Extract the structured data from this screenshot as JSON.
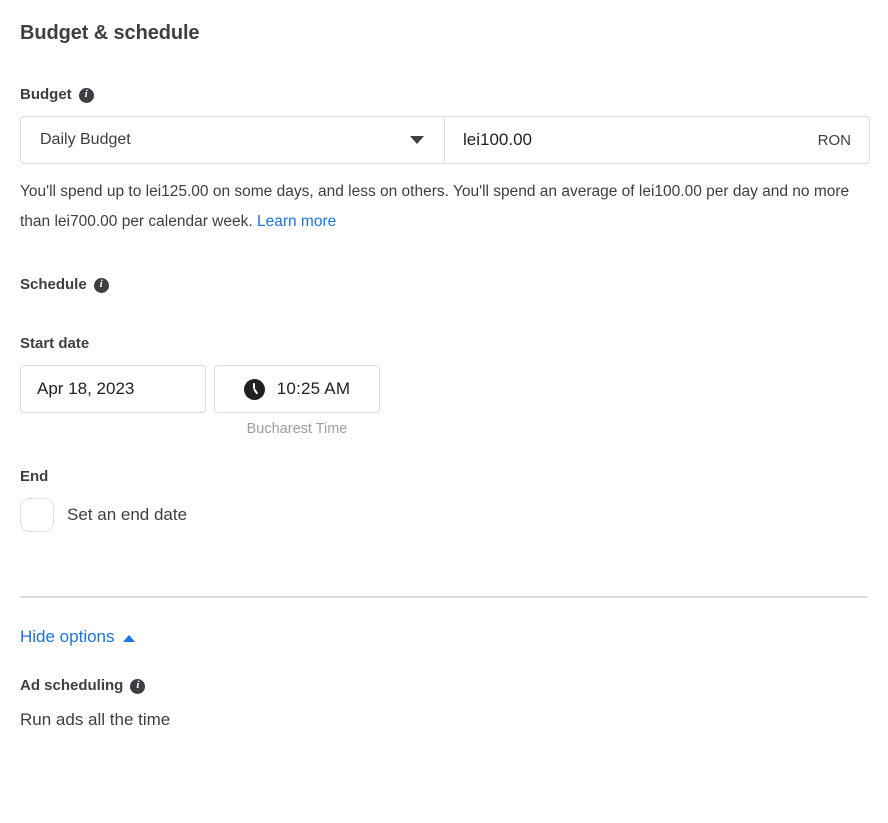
{
  "section": {
    "title": "Budget & schedule"
  },
  "budget": {
    "label": "Budget",
    "info_icon": "info-icon",
    "type_value": "Daily Budget",
    "caret_icon": "chevron-down-icon",
    "amount_value": "lei100.00",
    "currency": "RON",
    "helper_text_1": "You'll spend up to lei125.00 on some days, and less on others. You'll spend an average of lei100.00 per day and no more than lei700.00 per calendar week. ",
    "learn_more": "Learn more"
  },
  "schedule": {
    "label": "Schedule",
    "info_icon": "info-icon",
    "start_date_label": "Start date",
    "start_date_value": "Apr 18, 2023",
    "start_time_value": "10:25 AM",
    "clock_icon": "clock-icon",
    "timezone_note": "Bucharest Time",
    "end_label": "End",
    "end_checkbox_label": "Set an end date",
    "end_checkbox_checked": false
  },
  "options": {
    "toggle_label": "Hide options",
    "toggle_caret_icon": "chevron-up-icon",
    "ad_scheduling_label": "Ad scheduling",
    "ad_scheduling_info_icon": "info-icon",
    "ad_scheduling_value": "Run ads all the time"
  },
  "colors": {
    "link": "#1a73e8",
    "text": "#3c4043",
    "border": "#dadce0",
    "muted": "#9aa0a6"
  }
}
